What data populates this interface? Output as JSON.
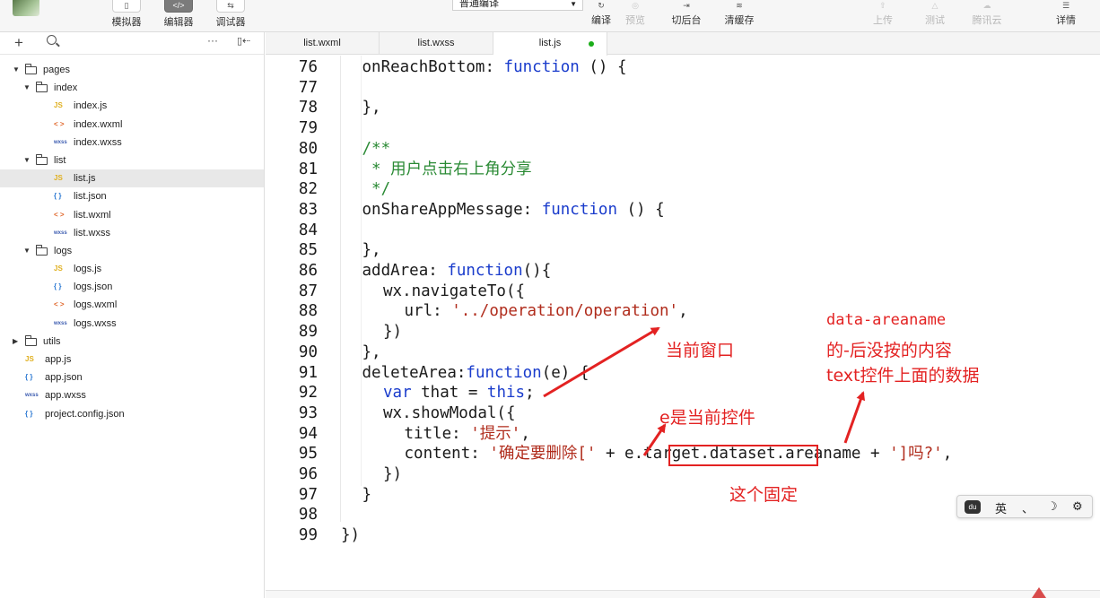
{
  "toolbar": {
    "simulator": "模拟器",
    "editor": "编辑器",
    "debugger": "调试器",
    "mode": "普通编译",
    "compile": "编译",
    "preview": "预览",
    "background": "切后台",
    "clear_cache": "清缓存",
    "upload": "上传",
    "test": "测试",
    "tencent_cloud": "腾讯云",
    "details": "详情"
  },
  "sidebar": {
    "tree": [
      {
        "label": "pages",
        "type": "folder",
        "depth": 0,
        "expanded": true
      },
      {
        "label": "index",
        "type": "folder",
        "depth": 1,
        "expanded": true
      },
      {
        "label": "index.js",
        "type": "js",
        "depth": 2
      },
      {
        "label": "index.wxml",
        "type": "wxml",
        "depth": 2
      },
      {
        "label": "index.wxss",
        "type": "wxss",
        "depth": 2
      },
      {
        "label": "list",
        "type": "folder",
        "depth": 1,
        "expanded": true
      },
      {
        "label": "list.js",
        "type": "js",
        "depth": 2,
        "selected": true
      },
      {
        "label": "list.json",
        "type": "json",
        "depth": 2
      },
      {
        "label": "list.wxml",
        "type": "wxml",
        "depth": 2
      },
      {
        "label": "list.wxss",
        "type": "wxss",
        "depth": 2
      },
      {
        "label": "logs",
        "type": "folder",
        "depth": 1,
        "expanded": true
      },
      {
        "label": "logs.js",
        "type": "js",
        "depth": 2
      },
      {
        "label": "logs.json",
        "type": "json",
        "depth": 2
      },
      {
        "label": "logs.wxml",
        "type": "wxml",
        "depth": 2
      },
      {
        "label": "logs.wxss",
        "type": "wxss",
        "depth": 2
      },
      {
        "label": "utils",
        "type": "folder",
        "depth": 0,
        "expanded": false
      },
      {
        "label": "app.js",
        "type": "js",
        "depth": 0
      },
      {
        "label": "app.json",
        "type": "json",
        "depth": 0
      },
      {
        "label": "app.wxss",
        "type": "wxss",
        "depth": 0
      },
      {
        "label": "project.config.json",
        "type": "json",
        "depth": 0
      }
    ],
    "icon_text": {
      "js": "JS",
      "json": "{ }",
      "wxml": "< >",
      "wxss": "wxss"
    }
  },
  "tabs": [
    {
      "label": "list.wxml"
    },
    {
      "label": "list.wxss"
    },
    {
      "label": "list.js",
      "active": true,
      "modified": true
    }
  ],
  "code": [
    {
      "n": "76",
      "ind": 1,
      "parts": [
        [
          "onReachBottom: ",
          ""
        ],
        [
          "function",
          "kw"
        ],
        [
          " () {",
          ""
        ]
      ]
    },
    {
      "n": "77",
      "ind": 0,
      "parts": []
    },
    {
      "n": "78",
      "ind": 1,
      "parts": [
        [
          "},",
          ""
        ]
      ]
    },
    {
      "n": "79",
      "ind": 0,
      "parts": []
    },
    {
      "n": "80",
      "ind": 1,
      "parts": [
        [
          "/**",
          "cm"
        ]
      ]
    },
    {
      "n": "81",
      "ind": 1,
      "parts": [
        [
          " * 用户点击右上角分享",
          "cm"
        ]
      ]
    },
    {
      "n": "82",
      "ind": 1,
      "parts": [
        [
          " */",
          "cm"
        ]
      ]
    },
    {
      "n": "83",
      "ind": 1,
      "parts": [
        [
          "onShareAppMessage: ",
          ""
        ],
        [
          "function",
          "kw"
        ],
        [
          " () {",
          ""
        ]
      ]
    },
    {
      "n": "84",
      "ind": 0,
      "parts": []
    },
    {
      "n": "85",
      "ind": 1,
      "parts": [
        [
          "},",
          ""
        ]
      ]
    },
    {
      "n": "86",
      "ind": 1,
      "parts": [
        [
          "addArea: ",
          ""
        ],
        [
          "function",
          "kw"
        ],
        [
          "(){",
          ""
        ]
      ]
    },
    {
      "n": "87",
      "ind": 2,
      "parts": [
        [
          "wx.navigateTo({",
          ""
        ]
      ]
    },
    {
      "n": "88",
      "ind": 3,
      "parts": [
        [
          "url: ",
          ""
        ],
        [
          "'../operation/operation'",
          "str"
        ],
        [
          ",",
          ""
        ]
      ]
    },
    {
      "n": "89",
      "ind": 2,
      "parts": [
        [
          "})",
          ""
        ]
      ]
    },
    {
      "n": "90",
      "ind": 1,
      "parts": [
        [
          "},",
          ""
        ]
      ]
    },
    {
      "n": "91",
      "ind": 1,
      "parts": [
        [
          "deleteArea:",
          ""
        ],
        [
          "function",
          "kw"
        ],
        [
          "(e) {",
          ""
        ]
      ]
    },
    {
      "n": "92",
      "ind": 2,
      "parts": [
        [
          "var",
          "kw"
        ],
        [
          " that = ",
          ""
        ],
        [
          "this",
          "kw"
        ],
        [
          ";",
          ""
        ]
      ]
    },
    {
      "n": "93",
      "ind": 2,
      "parts": [
        [
          "wx.showModal({",
          ""
        ]
      ]
    },
    {
      "n": "94",
      "ind": 3,
      "parts": [
        [
          "title: ",
          ""
        ],
        [
          "'提示'",
          "str"
        ],
        [
          ",",
          ""
        ]
      ]
    },
    {
      "n": "95",
      "ind": 3,
      "parts": [
        [
          "content: ",
          ""
        ],
        [
          "'确定要删除['",
          "str"
        ],
        [
          " + e.target.dataset.areaname + ",
          ""
        ],
        [
          "']吗?'",
          "str"
        ],
        [
          ",",
          ""
        ]
      ]
    },
    {
      "n": "96",
      "ind": 2,
      "parts": [
        [
          "})",
          ""
        ]
      ]
    },
    {
      "n": "97",
      "ind": 1,
      "parts": [
        [
          "}",
          ""
        ]
      ]
    },
    {
      "n": "98",
      "ind": 0,
      "parts": []
    },
    {
      "n": "99",
      "ind": 0,
      "parts": [
        [
          "})",
          ""
        ]
      ]
    }
  ],
  "annotations": {
    "current_window": "当前窗口",
    "areaname_line1": "data-areaname",
    "areaname_line2": "的-后没按的内容",
    "areaname_line3": "text控件上面的数据",
    "e_is_control": "e是当前控件",
    "fixed": "这个固定"
  },
  "ime": {
    "lang": "英",
    "punct": "、",
    "moon": "☽",
    "settings": "⚙"
  },
  "colors": {
    "keyword": "#1a3ccc",
    "string": "#b02c1c",
    "comment": "#2a8a34",
    "annotation": "#e32222",
    "modified_dot": "#1aad19"
  }
}
